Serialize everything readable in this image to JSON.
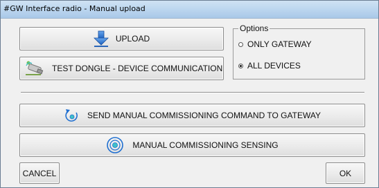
{
  "window": {
    "title": "#GW Interface radio - Manual upload"
  },
  "buttons": {
    "upload": "UPLOAD",
    "test_dongle": "TEST DONGLE - DEVICE COMMUNICATION",
    "send_commissioning": "SEND MANUAL COMMISSIONING COMMAND TO GATEWAY",
    "commissioning_sensing": "MANUAL COMMISSIONING SENSING",
    "cancel": "CANCEL",
    "ok": "OK"
  },
  "options": {
    "legend": "Options",
    "items": [
      {
        "label": "ONLY GATEWAY",
        "checked": false
      },
      {
        "label": "ALL DEVICES",
        "checked": true
      }
    ]
  },
  "icons": {
    "upload": "download-arrow-icon",
    "test_dongle": "usb-dongle-icon",
    "send_commissioning": "circular-arrow-icon",
    "commissioning_sensing": "sensing-target-icon"
  },
  "colors": {
    "accent_blue": "#1f6fd1",
    "teal": "#3fc1c9",
    "titlebar": "#bcd6ef"
  }
}
